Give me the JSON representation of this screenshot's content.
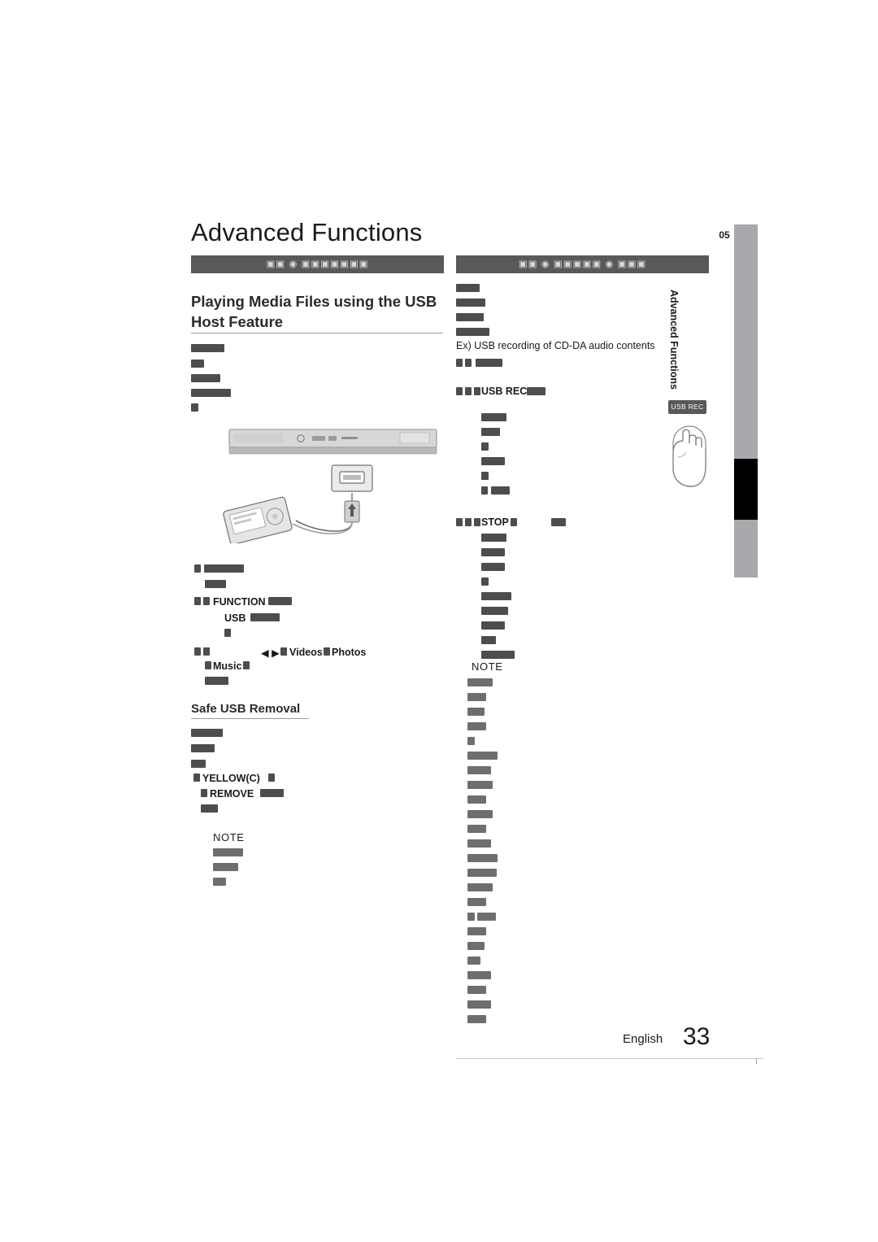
{
  "page": {
    "title": "Advanced Functions",
    "chapter_number": "05",
    "chapter_label": "Advanced Functions",
    "footer_language": "English",
    "footer_page": "33"
  },
  "left_column": {
    "bar_text": "▣▣ ◉ ▣▣▣▣▣▣▣",
    "section_title": "Playing Media Files using the USB Host Feature",
    "sub_section_title": "Safe USB Removal",
    "steps": [
      {
        "label": "FUNCTION",
        "trailing": "USB"
      },
      {
        "label": "Videos",
        "extra": "Photos",
        "extra2": "Music"
      }
    ],
    "function_label": "FUNCTION",
    "usb_label": "USB",
    "videos_label": "Videos",
    "photos_label": "Photos",
    "music_label": "Music",
    "yellow_label": "YELLOW(C)",
    "remove_label": "REMOVE",
    "note_label": "NOTE"
  },
  "right_column": {
    "bar_text": "▣▣ ◉ ▣▣▣▣▣ ◉ ▣▣▣",
    "example_line": "Ex) USB recording of CD-DA audio contents",
    "usb_rec_label": "USB REC",
    "stop_label": "STOP",
    "note_label": "NOTE"
  },
  "callout": {
    "button_label": "USB REC"
  },
  "colors": {
    "bar": "#58595b",
    "side_tab": "#a7a9ac",
    "redaction": "#4d4d4d"
  }
}
